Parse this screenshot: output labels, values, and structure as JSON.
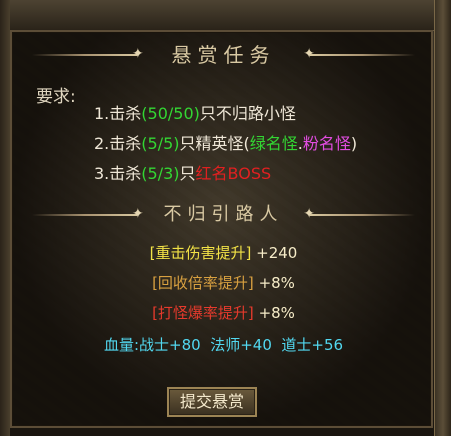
{
  "window": {
    "title": "悬赏任务"
  },
  "requirements": {
    "label": "要求:",
    "items": [
      {
        "prefix": "1.击杀",
        "count": "(50/50)",
        "suffix": "只不归路小怪"
      },
      {
        "prefix": "2.击杀",
        "count": "(5/5)",
        "suffix": "只精英怪(",
        "green": "绿名怪",
        "dot": ".",
        "pink": "粉名怪",
        "close": ")"
      },
      {
        "prefix": "3.击杀",
        "count": "(5/3)",
        "suffix": "只",
        "red": "红名BOSS"
      }
    ]
  },
  "reward": {
    "title": "不归引路人",
    "bonuses": [
      {
        "name": "[重击伤害提升]",
        "value": "+240"
      },
      {
        "name": "[回收倍率提升]",
        "value": "+8%"
      },
      {
        "name": "[打怪爆率提升]",
        "value": "+8%"
      }
    ],
    "hp": {
      "label": "血量:",
      "warrior": "战士+80",
      "mage": "法师+40",
      "taoist": "道士+56"
    }
  },
  "submit_button": "提交悬赏",
  "colors": {
    "green": "#33d633",
    "pink": "#e24de2",
    "red": "#e02020",
    "yellow": "#f2e246",
    "orange": "#d8a040",
    "cyan": "#52d8f0"
  }
}
